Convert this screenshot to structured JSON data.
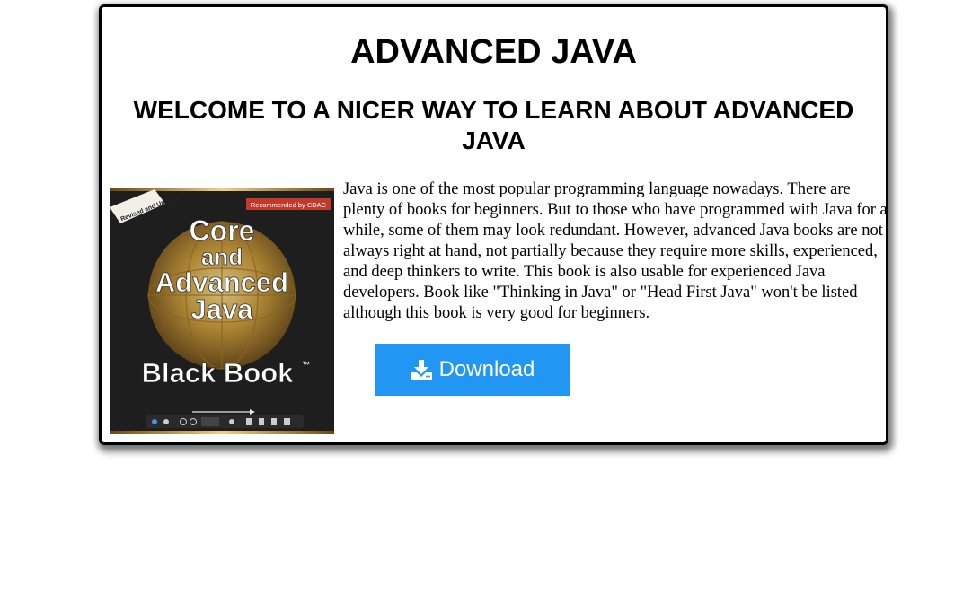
{
  "page": {
    "title": "ADVANCED JAVA",
    "subtitle": "WELCOME TO A NICER WAY TO LEARN ABOUT ADVANCED JAVA",
    "description": "Java is one of the most popular programming language nowadays. There are plenty of books for beginners. But to those who have programmed with Java for a while, some of them may look redundant. However, advanced Java books are not always right at hand, not partially because they require more skills, experienced, and deep thinkers to write. This book is also usable for experienced Java developers. Book like \"Thinking in Java\" or \"Head First Java\" won't be listed although this book is very good for beginners."
  },
  "book_cover": {
    "ribbon": "Revised and Upgraded",
    "badge": "Recommended by CDAC",
    "line1": "Core",
    "line2": "and",
    "line3": "Advanced",
    "line4": "Java",
    "line5": "Black Book",
    "trademark": "™"
  },
  "download": {
    "label": "Download",
    "icon": "download-icon"
  },
  "colors": {
    "button_bg": "#2196f3",
    "button_text": "#ffffff",
    "card_border": "#000000",
    "cover_bg": "#1e1e1e",
    "cover_gold": "#c89a3a"
  }
}
